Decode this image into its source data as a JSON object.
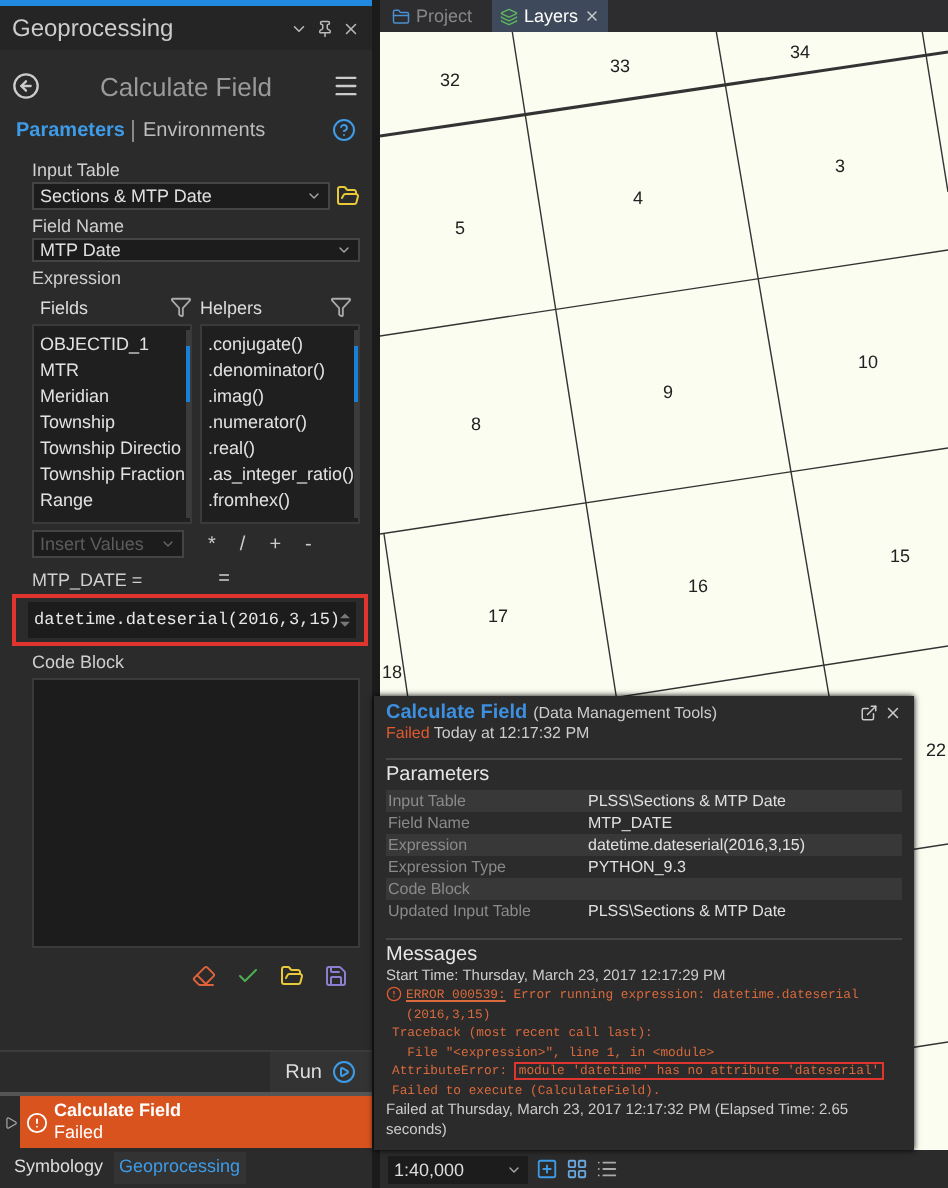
{
  "panel": {
    "title": "Geoprocessing",
    "tool_title": "Calculate Field",
    "tabs": [
      {
        "label": "Parameters",
        "selected": true
      },
      {
        "label": "Environments",
        "selected": false
      }
    ],
    "input_table": {
      "label": "Input Table",
      "value": "Sections & MTP Date"
    },
    "field_name": {
      "label": "Field Name",
      "value": "MTP Date"
    },
    "expression": {
      "label": "Expression",
      "fields_header": "Fields",
      "helpers_header": "Helpers",
      "fields": [
        "OBJECTID_1",
        "MTR",
        "Meridian",
        "Township",
        "Township Directio",
        "Township Fraction",
        "Range"
      ],
      "helpers": [
        ".conjugate()",
        ".denominator()",
        ".imag()",
        ".numerator()",
        ".real()",
        ".as_integer_ratio()",
        ".fromhex()"
      ],
      "insert_values": {
        "label": "Insert Values",
        "disabled": true
      },
      "operators": [
        "*",
        "/",
        "+",
        "-"
      ],
      "target": "MTP_DATE =",
      "operator_2": "=",
      "value": "datetime.dateserial(2016,3,15)",
      "highlighted": true
    },
    "code_block": {
      "label": "Code Block"
    },
    "run_button": "Run",
    "status": {
      "title": "Calculate Field",
      "state_label": "Failed"
    },
    "bottom_tabs": [
      {
        "label": "Symbology",
        "selected": false
      },
      {
        "label": "Geoprocessing",
        "selected": true
      }
    ]
  },
  "map": {
    "tabs": [
      {
        "label": "Project",
        "selected": false
      },
      {
        "label": "Layers",
        "selected": true
      }
    ],
    "section_labels": [
      "32",
      "33",
      "34",
      "3",
      "4",
      "5",
      "10",
      "9",
      "8",
      "15",
      "16",
      "17",
      "18",
      "22"
    ],
    "scale": "1:40,000"
  },
  "popup": {
    "title": "Calculate Field",
    "subtitle": "(Data Management Tools)",
    "state_label": "Failed",
    "time": "Today at 12:17:32 PM",
    "parameters_heading": "Parameters",
    "parameters": [
      {
        "name": "Input Table",
        "value": "PLSS\\Sections & MTP Date"
      },
      {
        "name": "Field Name",
        "value": "MTP_DATE"
      },
      {
        "name": "Expression",
        "value": "datetime.dateserial(2016,3,15)"
      },
      {
        "name": "Expression Type",
        "value": "PYTHON_9.3"
      },
      {
        "name": "Code Block"
      },
      {
        "name": "Updated Input Table",
        "value": "PLSS\\Sections & MTP Date"
      }
    ],
    "messages_heading": "Messages",
    "messages": [
      {
        "kind": "info",
        "text": "Start Time: Thursday, March 23, 2017 12:17:29 PM"
      },
      {
        "kind": "error",
        "link": "ERROR 000539:",
        "text": "Error running expression: datetime.dateserial (2016,3,15)"
      },
      {
        "kind": "error",
        "text": "Traceback (most recent call last):"
      },
      {
        "kind": "error",
        "text": "  File \"<expression>\", line 1, in <module>"
      },
      {
        "kind": "error",
        "text": "AttributeError:",
        "highlight": "module 'datetime' has no attribute 'dateserial'"
      },
      {
        "kind": "error",
        "text": "Failed to execute (CalculateField)."
      },
      {
        "kind": "info",
        "text": "Failed at Thursday, March 23, 2017 12:17:32 PM (Elapsed Time: 2.65 seconds)"
      }
    ]
  }
}
